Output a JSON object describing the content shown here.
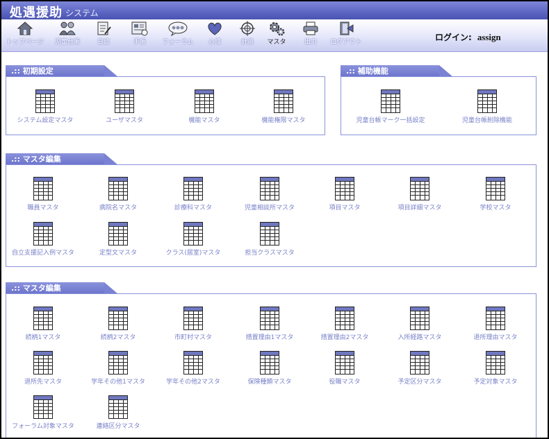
{
  "app": {
    "title": "処遇援助",
    "subtitle": "システム"
  },
  "nav": [
    {
      "label": "トップページ",
      "icon": "house-icon"
    },
    {
      "label": "児童台帳",
      "icon": "children-icon"
    },
    {
      "label": "日誌",
      "icon": "diary-icon"
    },
    {
      "label": "手帳",
      "icon": "notebook-icon"
    },
    {
      "label": "フォーラム",
      "icon": "forum-icon"
    },
    {
      "label": "心理",
      "icon": "heart-icon"
    },
    {
      "label": "計画",
      "icon": "target-icon"
    },
    {
      "label": "マスタ",
      "icon": "gear-icon"
    },
    {
      "label": "出力",
      "icon": "printer-icon"
    },
    {
      "label": "ログアウト",
      "icon": "logout-icon"
    }
  ],
  "login": {
    "label": "ログイン:",
    "user": "assign"
  },
  "sections": {
    "initial": {
      "title": ".:: 初期設定",
      "items": [
        "システム設定マスタ",
        "ユーザマスタ",
        "機能マスタ",
        "機能権限マスタ"
      ]
    },
    "support": {
      "title": ".:: 補助機能",
      "items": [
        "児童台帳マーク一括設定",
        "児童台帳削除機能"
      ]
    },
    "master1": {
      "title": ".:: マスタ編集",
      "items": [
        "職員マスタ",
        "病院名マスタ",
        "診療科マスタ",
        "児童相談所マスタ",
        "項目マスタ",
        "項目詳細マスタ",
        "学校マスタ",
        "自立支援記入例マスタ",
        "定型文マスタ",
        "クラス(居室)マスタ",
        "担当クラスマスタ"
      ]
    },
    "master2": {
      "title": ".:: マスタ編集",
      "items": [
        "続柄1マスタ",
        "続柄2マスタ",
        "市町村マスタ",
        "措置理由1マスタ",
        "措置理由2マスタ",
        "入所経路マスタ",
        "退所理由マスタ",
        "退所先マスタ",
        "学年その他1マスタ",
        "学年その他2マスタ",
        "保険種類マスタ",
        "役職マスタ",
        "予定区分マスタ",
        "予定対象マスタ",
        "フォーラム対象マスタ",
        "連絡区分マスタ"
      ]
    }
  }
}
